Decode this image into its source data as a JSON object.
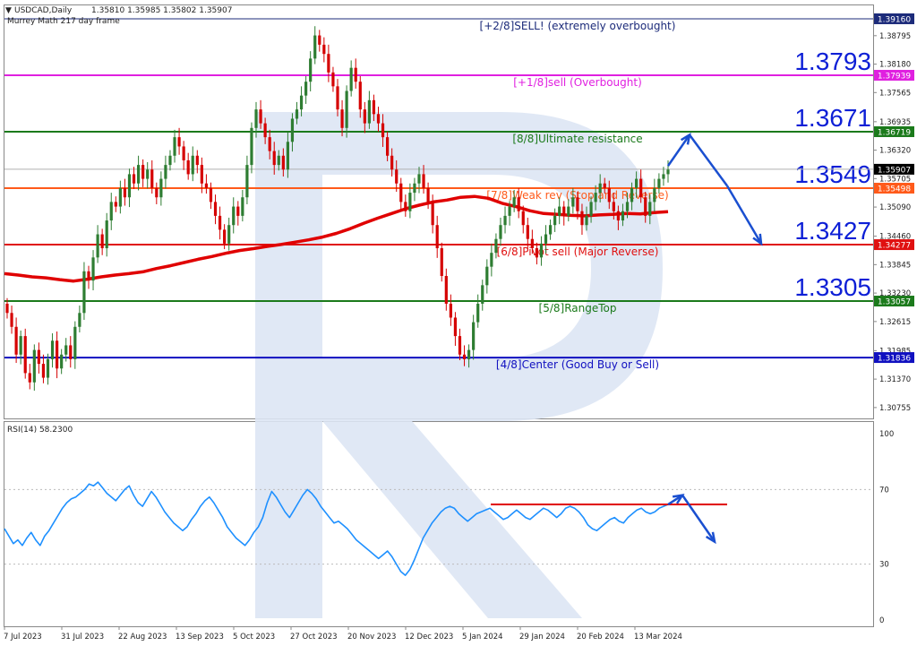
{
  "header": {
    "symbol": "USDCAD,Daily",
    "ohlc": "1.35810 1.35985 1.35802 1.35907",
    "indicator": "Murrey Math 217 day frame"
  },
  "rsi_label": "RSI(14) 58.2300",
  "colors": {
    "bull": "#2e7d32",
    "bear": "#d50000",
    "ma": "#e00000",
    "rsi": "#1e90ff",
    "arrow": "#1a4fd0",
    "watermark": "#dde6f4"
  },
  "chart_data": [
    {
      "type": "candlestick",
      "ylim": [
        1.3052,
        1.3945
      ],
      "price_ticks": [
        "1.39160",
        "1.38795",
        "1.38180",
        "1.37565",
        "1.36935",
        "1.36320",
        "1.35705",
        "1.35090",
        "1.34460",
        "1.33845",
        "1.33230",
        "1.32615",
        "1.31985",
        "1.31370",
        "1.30755"
      ],
      "x_ticks": [
        "7 Jul 2023",
        "31 Jul 2023",
        "22 Aug 2023",
        "13 Sep 2023",
        "5 Oct 2023",
        "27 Oct 2023",
        "20 Nov 2023",
        "12 Dec 2023",
        "5 Jan 2024",
        "29 Jan 2024",
        "20 Feb 2024",
        "13 Mar 2024"
      ],
      "current_price": 1.35907,
      "murrey_levels": [
        {
          "price": 1.3916,
          "tag": "1.39160",
          "label": "[+2/8]SELL! (extremely overbought)",
          "color": "#1c2b7a",
          "big": ""
        },
        {
          "price": 1.37939,
          "tag": "1.37939",
          "label": "[+1/8]sell (Overbought)",
          "color": "#e020e0",
          "big": "1.3793"
        },
        {
          "price": 1.36719,
          "tag": "1.36719",
          "label": "[8/8]Ultimate resistance",
          "color": "#1b7a1b",
          "big": "1.3671"
        },
        {
          "price": 1.35498,
          "tag": "1.35498",
          "label": "[7/8]Weak rev (Stop and Reverse)",
          "color": "#ff5a1a",
          "big": "1.3549"
        },
        {
          "price": 1.34277,
          "tag": "1.34277",
          "label": "[6/8]Pivot sell (Major Reverse)",
          "color": "#e01010",
          "big": "1.3427"
        },
        {
          "price": 1.33057,
          "tag": "1.33057",
          "label": "[5/8]RangeTop",
          "color": "#1b7a1b",
          "big": "1.3305"
        },
        {
          "price": 1.31836,
          "tag": "1.31836",
          "label": "[4/8]Center (Good Buy or Sell)",
          "color": "#1010c0",
          "big": ""
        }
      ],
      "closes": [
        1.328,
        1.325,
        1.319,
        1.323,
        1.315,
        1.313,
        1.32,
        1.317,
        1.314,
        1.318,
        1.322,
        1.316,
        1.319,
        1.321,
        1.318,
        1.325,
        1.328,
        1.337,
        1.335,
        1.34,
        1.345,
        1.342,
        1.348,
        1.352,
        1.351,
        1.355,
        1.353,
        1.358,
        1.356,
        1.36,
        1.357,
        1.359,
        1.355,
        1.353,
        1.357,
        1.36,
        1.362,
        1.366,
        1.364,
        1.361,
        1.358,
        1.362,
        1.36,
        1.356,
        1.355,
        1.352,
        1.349,
        1.346,
        1.343,
        1.347,
        1.351,
        1.349,
        1.353,
        1.36,
        1.368,
        1.372,
        1.369,
        1.366,
        1.363,
        1.36,
        1.362,
        1.359,
        1.365,
        1.37,
        1.372,
        1.375,
        1.378,
        1.383,
        1.388,
        1.386,
        1.384,
        1.38,
        1.377,
        1.372,
        1.368,
        1.376,
        1.381,
        1.378,
        1.372,
        1.369,
        1.374,
        1.371,
        1.369,
        1.366,
        1.362,
        1.359,
        1.356,
        1.352,
        1.35,
        1.354,
        1.356,
        1.358,
        1.355,
        1.352,
        1.347,
        1.342,
        1.336,
        1.33,
        1.327,
        1.323,
        1.319,
        1.318,
        1.32,
        1.326,
        1.33,
        1.334,
        1.338,
        1.341,
        1.344,
        1.347,
        1.349,
        1.351,
        1.353,
        1.35,
        1.347,
        1.344,
        1.342,
        1.34,
        1.343,
        1.345,
        1.347,
        1.349,
        1.351,
        1.349,
        1.351,
        1.353,
        1.35,
        1.347,
        1.349,
        1.352,
        1.354,
        1.356,
        1.355,
        1.352,
        1.35,
        1.348,
        1.35,
        1.352,
        1.355,
        1.357,
        1.353,
        1.349,
        1.352,
        1.355,
        1.357,
        1.358,
        1.359
      ],
      "ma_200": [
        1.3365,
        1.3362,
        1.3358,
        1.3356,
        1.3352,
        1.3349,
        1.3353,
        1.3358,
        1.3362,
        1.3365,
        1.3369,
        1.3376,
        1.3382,
        1.3389,
        1.3396,
        1.3402,
        1.3409,
        1.3415,
        1.3419,
        1.3424,
        1.3428,
        1.3433,
        1.3438,
        1.3444,
        1.3452,
        1.3462,
        1.3474,
        1.3485,
        1.3495,
        1.3505,
        1.3513,
        1.352,
        1.3524,
        1.353,
        1.3532,
        1.3528,
        1.3517,
        1.351,
        1.3501,
        1.3495,
        1.3493,
        1.3491,
        1.349,
        1.3492,
        1.3493,
        1.3495,
        1.3494,
        1.3497,
        1.3499
      ],
      "arrows": [
        [
          1.3598,
          1.3665
        ],
        [
          1.3665,
          1.3555
        ],
        [
          1.3555,
          1.343
        ]
      ]
    },
    {
      "type": "line",
      "name": "RSI(14)",
      "ylim": [
        0,
        100
      ],
      "ticks": [
        "100",
        "70",
        "30",
        "0"
      ],
      "levels": [
        70,
        30
      ],
      "values": [
        49,
        45,
        41,
        43,
        40,
        44,
        47,
        43,
        40,
        45,
        48,
        52,
        56,
        60,
        63,
        65,
        66,
        68,
        70,
        73,
        72,
        74,
        71,
        68,
        66,
        64,
        67,
        70,
        72,
        67,
        63,
        61,
        65,
        69,
        66,
        62,
        58,
        55,
        52,
        50,
        48,
        50,
        54,
        57,
        61,
        64,
        66,
        63,
        59,
        55,
        50,
        47,
        44,
        42,
        40,
        43,
        47,
        50,
        55,
        63,
        69,
        66,
        62,
        58,
        55,
        59,
        63,
        67,
        70,
        68,
        65,
        61,
        58,
        55,
        52,
        53,
        51,
        49,
        46,
        43,
        41,
        39,
        37,
        35,
        33,
        35,
        37,
        34,
        30,
        26,
        24,
        27,
        32,
        38,
        44,
        48,
        52,
        55,
        58,
        60,
        61,
        60,
        57,
        55,
        53,
        55,
        57,
        58,
        59,
        60,
        58,
        56,
        54,
        55,
        57,
        59,
        57,
        55,
        54,
        56,
        58,
        60,
        59,
        57,
        55,
        57,
        60,
        61,
        60,
        58,
        55,
        51,
        49,
        48,
        50,
        52,
        54,
        55,
        53,
        52,
        55,
        57,
        59,
        60,
        58,
        57,
        58,
        60,
        61,
        62
      ],
      "resistance": 62,
      "arrows": [
        [
          62,
          67
        ],
        [
          67,
          42
        ]
      ]
    }
  ]
}
